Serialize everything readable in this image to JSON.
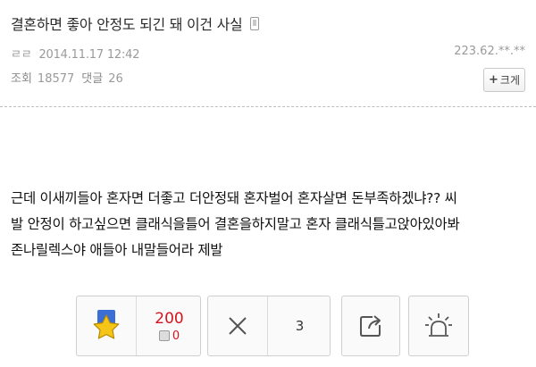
{
  "post": {
    "title": "결혼하면 좋아 안정도 되긴 돼 이건 사실",
    "author": "ㄹㄹ",
    "date": "2014.11.17 12:42",
    "ip": "223.62.**.**",
    "views_label": "조회",
    "views": "18577",
    "comments_label": "댓글",
    "comments": "26",
    "enlarge_label": "크게",
    "body_lines": [
      "근데 이새끼들아 혼자면 더좋고 더안정돼 혼자벌어 혼자살면 돈부족하겠냐?? 씨",
      "발 안정이 하고싶으면 클래식을틀어 결혼을하지말고 혼자 클래식틀고앉아있아봐",
      "존나릴렉스야 애들아 내말들어라 제발"
    ]
  },
  "actions": {
    "recommend_count": "200",
    "recommend_sub_count": "0",
    "oppose_count": "3"
  },
  "icons": {
    "recommend": "star-icon",
    "oppose": "x-icon",
    "share": "share-icon",
    "report": "siren-icon",
    "mobile": "mobile-icon"
  },
  "colors": {
    "recommend_count": "#d4141e",
    "star_fill": "#f5c518",
    "star_badge": "#3b6fd6"
  }
}
